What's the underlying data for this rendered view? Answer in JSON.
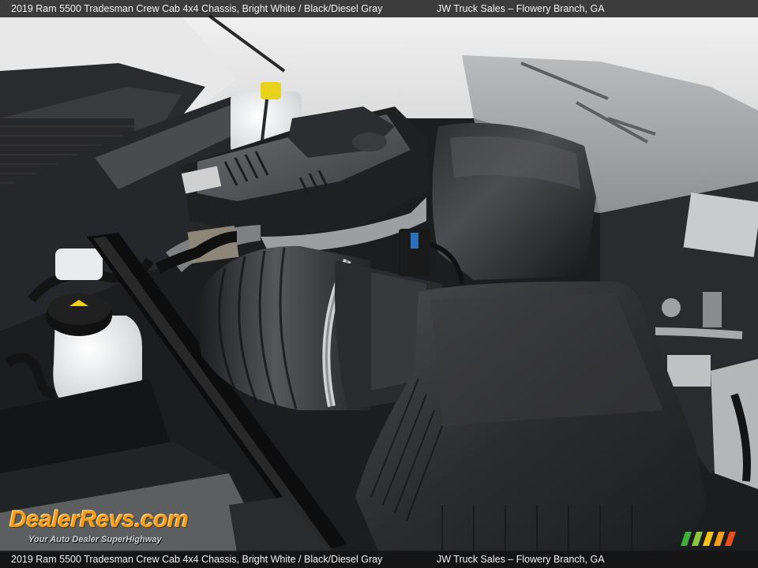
{
  "caption": {
    "title": "2019 Ram 5500 Tradesman Crew Cab 4x4 Chassis,  Bright White / Black/Diesel Gray",
    "dealer": "JW Truck Sales – Flowery Branch, GA"
  },
  "watermark": {
    "logo": "DealerRevs.com",
    "tagline": "Your Auto Dealer SuperHighway"
  },
  "colors": {
    "caption_bg": "#141414",
    "logo_orange": "#f39c1e",
    "stripe_1": "#3fae3a",
    "stripe_2": "#8cc63f",
    "stripe_3": "#f7c31a",
    "stripe_4": "#f39c1e",
    "stripe_5": "#e94e1b"
  }
}
